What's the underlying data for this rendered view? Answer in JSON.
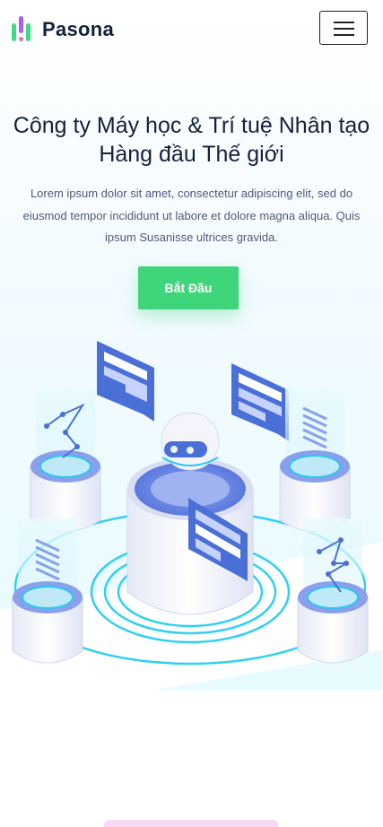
{
  "header": {
    "brand_name": "Pasona",
    "logo_icon": "pasona-logo-icon",
    "menu_icon": "hamburger-menu-icon"
  },
  "hero": {
    "title": "Công ty Máy học & Trí tuệ Nhân tạo Hàng đầu Thế giới",
    "description": "Lorem ipsum dolor sit amet, consectetur adipiscing elit, sed do eiusmod tempor incididunt ut labore et dolore magna aliqua. Quis ipsum Susanisse ultrices gravida.",
    "cta_label": "Bắt Đầu",
    "illustration_icon": "ai-robot-illustration"
  },
  "colors": {
    "accent_green": "#3fd57a",
    "heading": "#14213d",
    "body_text": "#4e5a7a",
    "illustration_blue": "#4a6fd6",
    "illustration_cyan": "#29c9ec"
  }
}
